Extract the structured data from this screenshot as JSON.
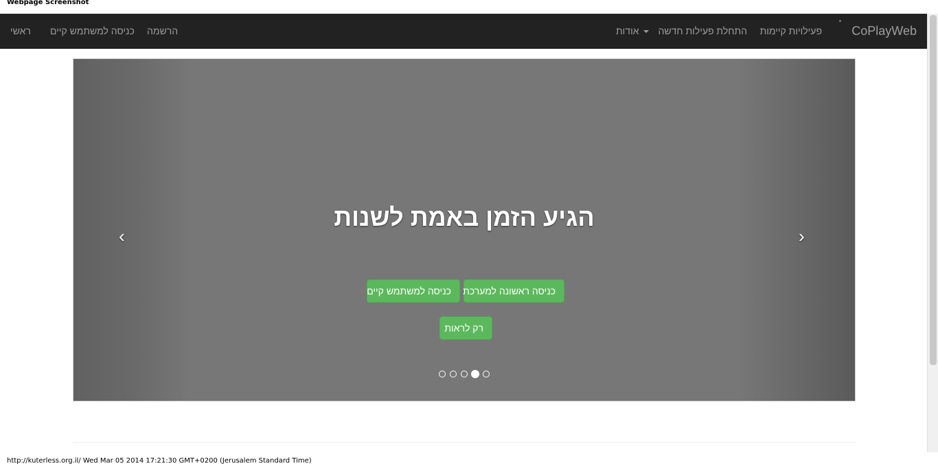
{
  "page_label": "Webpage Screenshot",
  "navbar": {
    "brand": "CoPlayWeb",
    "items": [
      {
        "label": "פעילויות קיימות"
      },
      {
        "label": "התחלת פעילות חדשה"
      },
      {
        "label": "אודות",
        "dropdown": true
      }
    ],
    "left_items": [
      {
        "label": "הרשמה"
      },
      {
        "label": "כניסה למשתמש קיים"
      },
      {
        "label": "ראשי"
      }
    ]
  },
  "carousel": {
    "headline": "הגיע הזמן באמת לשנות",
    "buttons": {
      "first_login": "כניסה ראשונה למערכת",
      "existing_user": "כניסה למשתמש קיים",
      "just_browse": "רק לראות"
    },
    "prev_icon": "chevron-left-icon",
    "next_icon": "chevron-right-icon",
    "slide_count": 5,
    "active_slide": 4
  },
  "footer": {
    "url_timestamp": "http://kuterless.org.il/ Wed Mar 05 2014 17:21:30 GMT+0200 (Jerusalem Standard Time)"
  },
  "colors": {
    "navbar_bg": "#222222",
    "nav_text": "#9d9d9d",
    "button_green": "#5cb85c",
    "carousel_bg": "#777777"
  }
}
